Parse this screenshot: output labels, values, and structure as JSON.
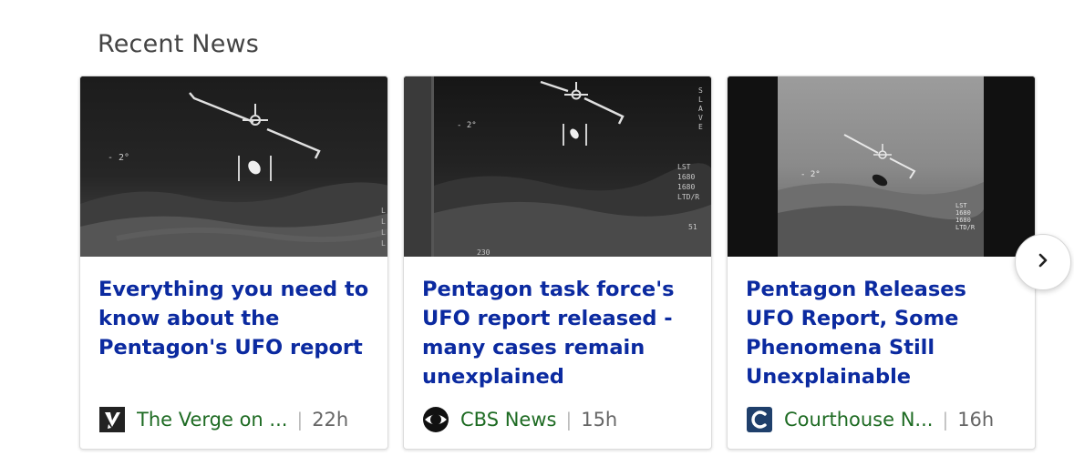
{
  "section": {
    "title": "Recent News"
  },
  "cards": [
    {
      "headline": "Everything you need to know about the Pentagon's UFO report",
      "source": "The Verge on ...",
      "time": "22h",
      "logo_icon": "verge-logo-icon"
    },
    {
      "headline": "Pentagon task force's UFO report released - many cases remain unexplained",
      "source": "CBS News",
      "time": "15h",
      "logo_icon": "cbs-eye-logo-icon"
    },
    {
      "headline": "Pentagon Releases UFO Report, Some Phenomena Still Unexplainable",
      "source": "Courthouse N...",
      "time": "16h",
      "logo_icon": "courthouse-news-logo-icon"
    }
  ],
  "controls": {
    "next_icon": "chevron-right-icon"
  },
  "colors": {
    "headline": "#0b2aa0",
    "source": "#1e6b23",
    "time": "#666666",
    "title": "#444444"
  }
}
